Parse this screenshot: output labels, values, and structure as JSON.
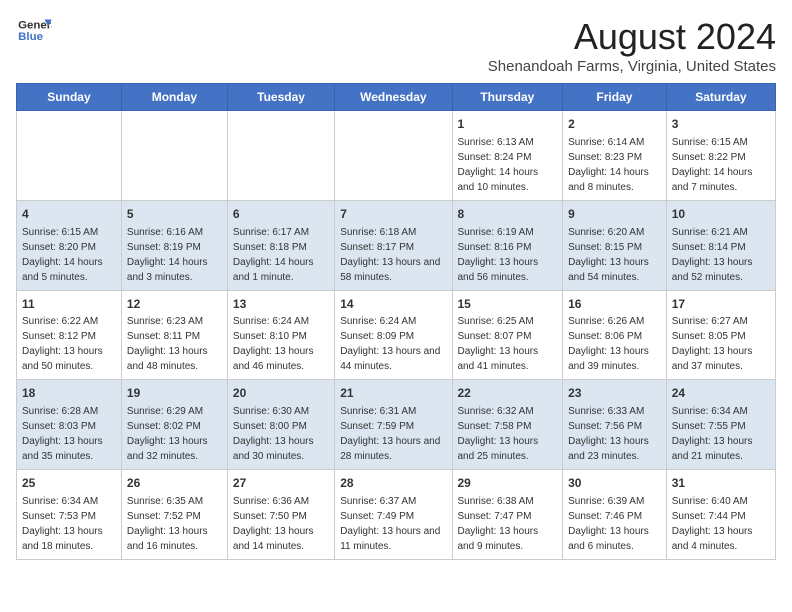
{
  "header": {
    "logo_line1": "General",
    "logo_line2": "Blue",
    "main_title": "August 2024",
    "subtitle": "Shenandoah Farms, Virginia, United States"
  },
  "days_of_week": [
    "Sunday",
    "Monday",
    "Tuesday",
    "Wednesday",
    "Thursday",
    "Friday",
    "Saturday"
  ],
  "weeks": [
    [
      {
        "day": "",
        "sunrise": "",
        "sunset": "",
        "daylight": ""
      },
      {
        "day": "",
        "sunrise": "",
        "sunset": "",
        "daylight": ""
      },
      {
        "day": "",
        "sunrise": "",
        "sunset": "",
        "daylight": ""
      },
      {
        "day": "",
        "sunrise": "",
        "sunset": "",
        "daylight": ""
      },
      {
        "day": "1",
        "sunrise": "Sunrise: 6:13 AM",
        "sunset": "Sunset: 8:24 PM",
        "daylight": "Daylight: 14 hours and 10 minutes."
      },
      {
        "day": "2",
        "sunrise": "Sunrise: 6:14 AM",
        "sunset": "Sunset: 8:23 PM",
        "daylight": "Daylight: 14 hours and 8 minutes."
      },
      {
        "day": "3",
        "sunrise": "Sunrise: 6:15 AM",
        "sunset": "Sunset: 8:22 PM",
        "daylight": "Daylight: 14 hours and 7 minutes."
      }
    ],
    [
      {
        "day": "4",
        "sunrise": "Sunrise: 6:15 AM",
        "sunset": "Sunset: 8:20 PM",
        "daylight": "Daylight: 14 hours and 5 minutes."
      },
      {
        "day": "5",
        "sunrise": "Sunrise: 6:16 AM",
        "sunset": "Sunset: 8:19 PM",
        "daylight": "Daylight: 14 hours and 3 minutes."
      },
      {
        "day": "6",
        "sunrise": "Sunrise: 6:17 AM",
        "sunset": "Sunset: 8:18 PM",
        "daylight": "Daylight: 14 hours and 1 minute."
      },
      {
        "day": "7",
        "sunrise": "Sunrise: 6:18 AM",
        "sunset": "Sunset: 8:17 PM",
        "daylight": "Daylight: 13 hours and 58 minutes."
      },
      {
        "day": "8",
        "sunrise": "Sunrise: 6:19 AM",
        "sunset": "Sunset: 8:16 PM",
        "daylight": "Daylight: 13 hours and 56 minutes."
      },
      {
        "day": "9",
        "sunrise": "Sunrise: 6:20 AM",
        "sunset": "Sunset: 8:15 PM",
        "daylight": "Daylight: 13 hours and 54 minutes."
      },
      {
        "day": "10",
        "sunrise": "Sunrise: 6:21 AM",
        "sunset": "Sunset: 8:14 PM",
        "daylight": "Daylight: 13 hours and 52 minutes."
      }
    ],
    [
      {
        "day": "11",
        "sunrise": "Sunrise: 6:22 AM",
        "sunset": "Sunset: 8:12 PM",
        "daylight": "Daylight: 13 hours and 50 minutes."
      },
      {
        "day": "12",
        "sunrise": "Sunrise: 6:23 AM",
        "sunset": "Sunset: 8:11 PM",
        "daylight": "Daylight: 13 hours and 48 minutes."
      },
      {
        "day": "13",
        "sunrise": "Sunrise: 6:24 AM",
        "sunset": "Sunset: 8:10 PM",
        "daylight": "Daylight: 13 hours and 46 minutes."
      },
      {
        "day": "14",
        "sunrise": "Sunrise: 6:24 AM",
        "sunset": "Sunset: 8:09 PM",
        "daylight": "Daylight: 13 hours and 44 minutes."
      },
      {
        "day": "15",
        "sunrise": "Sunrise: 6:25 AM",
        "sunset": "Sunset: 8:07 PM",
        "daylight": "Daylight: 13 hours and 41 minutes."
      },
      {
        "day": "16",
        "sunrise": "Sunrise: 6:26 AM",
        "sunset": "Sunset: 8:06 PM",
        "daylight": "Daylight: 13 hours and 39 minutes."
      },
      {
        "day": "17",
        "sunrise": "Sunrise: 6:27 AM",
        "sunset": "Sunset: 8:05 PM",
        "daylight": "Daylight: 13 hours and 37 minutes."
      }
    ],
    [
      {
        "day": "18",
        "sunrise": "Sunrise: 6:28 AM",
        "sunset": "Sunset: 8:03 PM",
        "daylight": "Daylight: 13 hours and 35 minutes."
      },
      {
        "day": "19",
        "sunrise": "Sunrise: 6:29 AM",
        "sunset": "Sunset: 8:02 PM",
        "daylight": "Daylight: 13 hours and 32 minutes."
      },
      {
        "day": "20",
        "sunrise": "Sunrise: 6:30 AM",
        "sunset": "Sunset: 8:00 PM",
        "daylight": "Daylight: 13 hours and 30 minutes."
      },
      {
        "day": "21",
        "sunrise": "Sunrise: 6:31 AM",
        "sunset": "Sunset: 7:59 PM",
        "daylight": "Daylight: 13 hours and 28 minutes."
      },
      {
        "day": "22",
        "sunrise": "Sunrise: 6:32 AM",
        "sunset": "Sunset: 7:58 PM",
        "daylight": "Daylight: 13 hours and 25 minutes."
      },
      {
        "day": "23",
        "sunrise": "Sunrise: 6:33 AM",
        "sunset": "Sunset: 7:56 PM",
        "daylight": "Daylight: 13 hours and 23 minutes."
      },
      {
        "day": "24",
        "sunrise": "Sunrise: 6:34 AM",
        "sunset": "Sunset: 7:55 PM",
        "daylight": "Daylight: 13 hours and 21 minutes."
      }
    ],
    [
      {
        "day": "25",
        "sunrise": "Sunrise: 6:34 AM",
        "sunset": "Sunset: 7:53 PM",
        "daylight": "Daylight: 13 hours and 18 minutes."
      },
      {
        "day": "26",
        "sunrise": "Sunrise: 6:35 AM",
        "sunset": "Sunset: 7:52 PM",
        "daylight": "Daylight: 13 hours and 16 minutes."
      },
      {
        "day": "27",
        "sunrise": "Sunrise: 6:36 AM",
        "sunset": "Sunset: 7:50 PM",
        "daylight": "Daylight: 13 hours and 14 minutes."
      },
      {
        "day": "28",
        "sunrise": "Sunrise: 6:37 AM",
        "sunset": "Sunset: 7:49 PM",
        "daylight": "Daylight: 13 hours and 11 minutes."
      },
      {
        "day": "29",
        "sunrise": "Sunrise: 6:38 AM",
        "sunset": "Sunset: 7:47 PM",
        "daylight": "Daylight: 13 hours and 9 minutes."
      },
      {
        "day": "30",
        "sunrise": "Sunrise: 6:39 AM",
        "sunset": "Sunset: 7:46 PM",
        "daylight": "Daylight: 13 hours and 6 minutes."
      },
      {
        "day": "31",
        "sunrise": "Sunrise: 6:40 AM",
        "sunset": "Sunset: 7:44 PM",
        "daylight": "Daylight: 13 hours and 4 minutes."
      }
    ]
  ]
}
